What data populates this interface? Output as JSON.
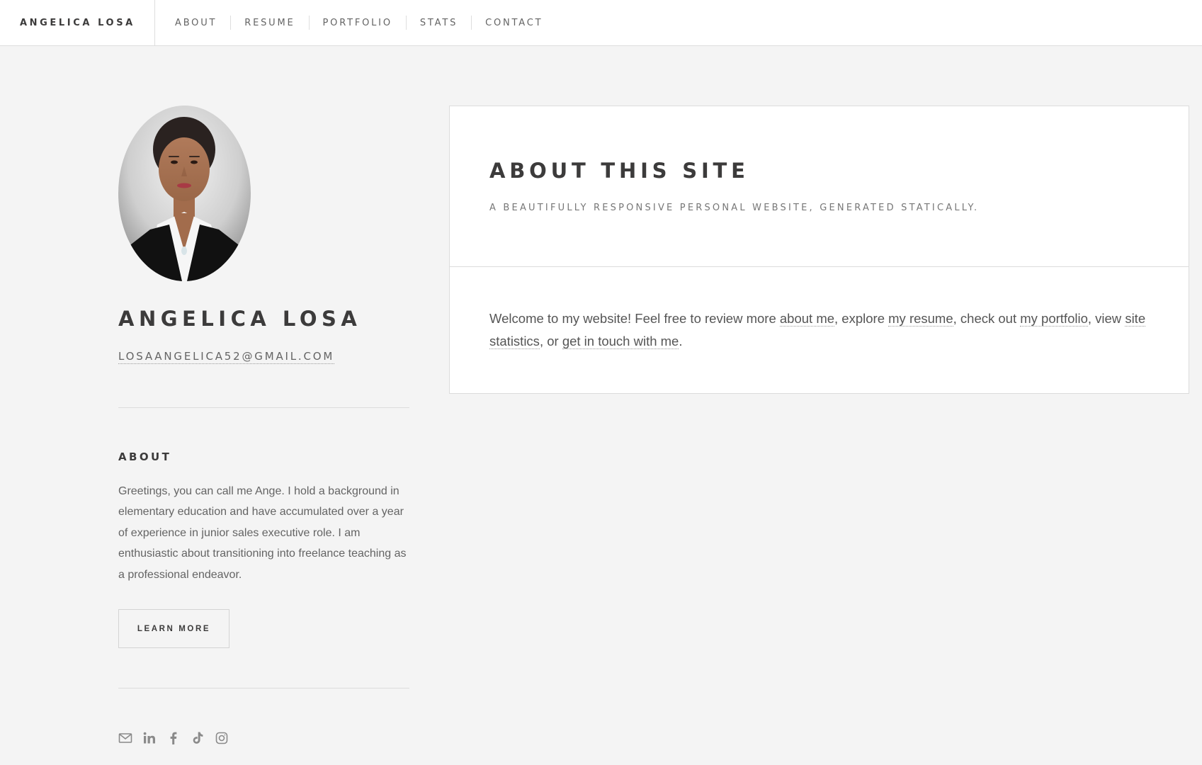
{
  "header": {
    "brand": "ANGELICA LOSA",
    "nav": [
      {
        "label": "ABOUT"
      },
      {
        "label": "RESUME"
      },
      {
        "label": "PORTFOLIO"
      },
      {
        "label": "STATS"
      },
      {
        "label": "CONTACT"
      }
    ]
  },
  "sidebar": {
    "name": "ANGELICA LOSA",
    "email": "LOSAANGELICA52@GMAIL.COM",
    "about_heading": "ABOUT",
    "about_text": "Greetings, you can call me Ange. I hold a background in elementary education and have accumulated over a year of experience in junior sales executive role. I am enthusiastic about transitioning into freelance teaching as a professional endeavor.",
    "learn_more": "LEARN MORE",
    "social_icons": [
      "mail-icon",
      "linkedin-icon",
      "facebook-icon",
      "tiktok-icon",
      "instagram-icon"
    ]
  },
  "main": {
    "title": "ABOUT THIS SITE",
    "subtitle": "A BEAUTIFULLY RESPONSIVE PERSONAL WEBSITE, GENERATED STATICALLY.",
    "welcome": {
      "t1": "Welcome to my website! Feel free to review more ",
      "l1": "about me",
      "t2": ", explore ",
      "l2": "my resume",
      "t3": ", check out ",
      "l3": "my portfolio",
      "t4": ", view ",
      "l4": "site statistics",
      "t5": ", or ",
      "l5": "get in touch with me",
      "t6": "."
    }
  },
  "colors": {
    "background": "#f4f4f4",
    "card": "#ffffff",
    "text_dark": "#3c3b3b",
    "text_muted": "#646464",
    "border": "#dcdcdc"
  }
}
